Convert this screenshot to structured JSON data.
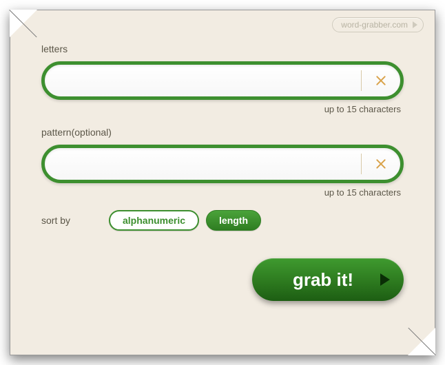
{
  "brand": {
    "label": "word-grabber.com"
  },
  "letters": {
    "label": "letters",
    "value": "",
    "hint": "up to 15 characters"
  },
  "pattern": {
    "label": "pattern(optional)",
    "value": "",
    "hint": "up to 15 characters"
  },
  "sort": {
    "label": "sort by",
    "options": {
      "alpha": "alphanumeric",
      "length": "length"
    },
    "selected": "length"
  },
  "submit": {
    "label": "grab it!"
  }
}
